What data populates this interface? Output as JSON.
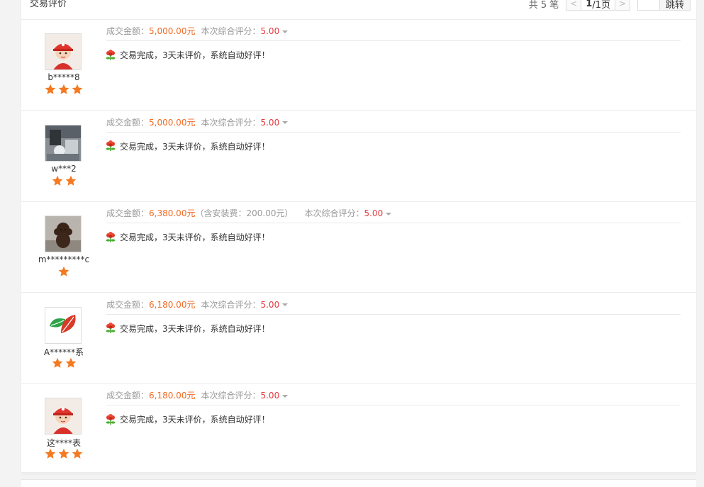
{
  "header": {
    "title": "交易评价",
    "pager": {
      "total_text": "共 5 笔",
      "prev_label": "<",
      "next_label": ">",
      "current_page": "1",
      "page_suffix": "/1页",
      "input_value": "",
      "jump_label": "跳转"
    }
  },
  "labels": {
    "amount_prefix": "成交金额：",
    "score_prefix": "本次综合评分："
  },
  "colors": {
    "amount": "#f06a24",
    "score": "#e4393c",
    "star": "#f47920"
  },
  "reviews": [
    {
      "username": "b*****8",
      "avatar": "red-cap-kid-avatar",
      "stars": 3,
      "amount": "5,000.00元",
      "fee": "",
      "score": "5.00",
      "comment": "交易完成，3天未评价，系统自动好评！"
    },
    {
      "username": "w***2",
      "avatar": "photo-room-avatar",
      "stars": 2,
      "amount": "5,000.00元",
      "fee": "",
      "score": "5.00",
      "comment": "交易完成，3天未评价，系统自动好评！"
    },
    {
      "username": "m*********c",
      "avatar": "poodle-dog-avatar",
      "stars": 1,
      "amount": "6,380.00元",
      "fee": "（含安装费：200.00元）",
      "score": "5.00",
      "comment": "交易完成，3天未评价，系统自动好评！"
    },
    {
      "username": "A******系",
      "avatar": "leaf-logo-avatar",
      "stars": 2,
      "amount": "6,180.00元",
      "fee": "",
      "score": "5.00",
      "comment": "交易完成，3天未评价，系统自动好评！"
    },
    {
      "username": "这****表",
      "avatar": "red-cap-kid-avatar",
      "stars": 3,
      "amount": "6,180.00元",
      "fee": "",
      "score": "5.00",
      "comment": "交易完成，3天未评价，系统自动好评！"
    }
  ]
}
